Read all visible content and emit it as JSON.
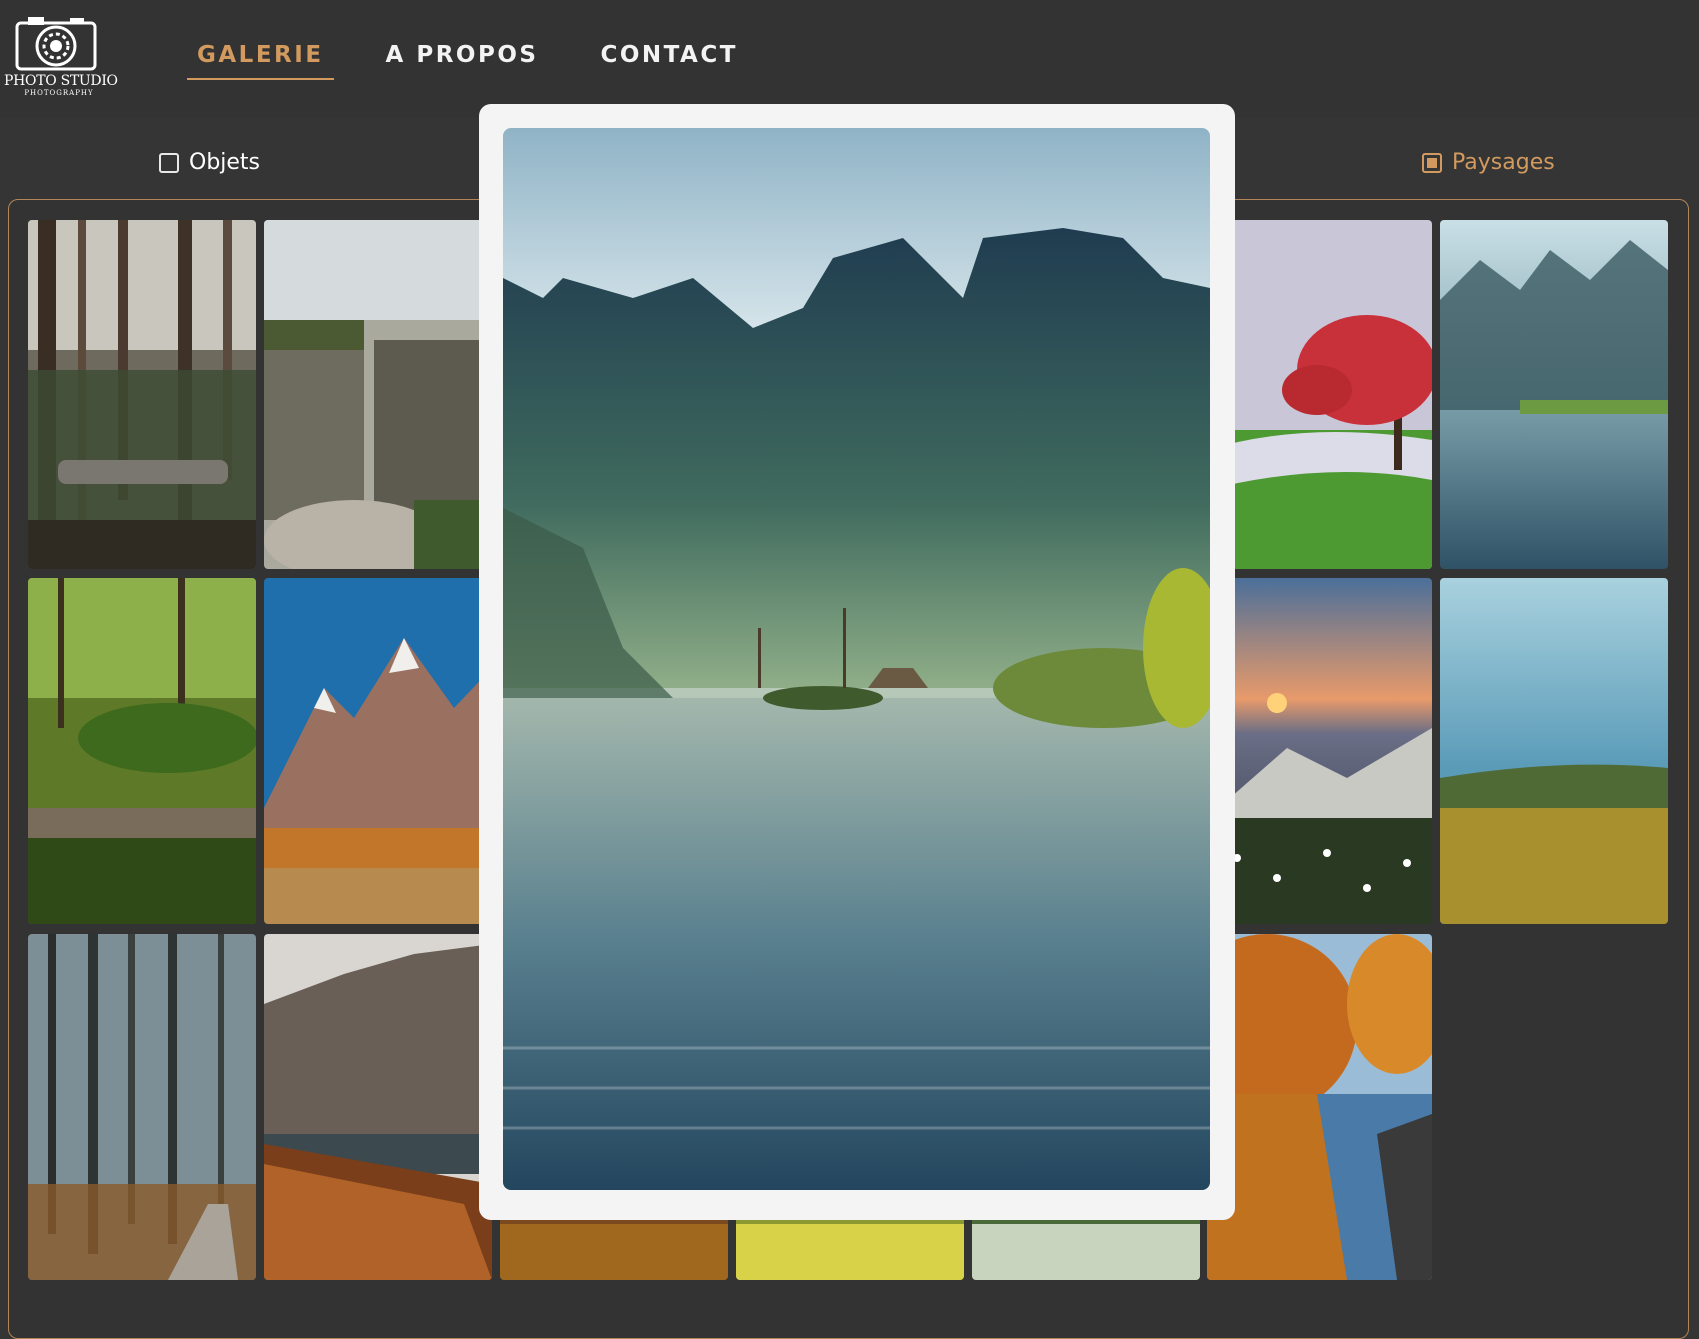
{
  "brand": {
    "name": "PHOTO STUDIO",
    "tagline": "PHOTOGRAPHY",
    "icon": "camera-icon"
  },
  "nav": {
    "items": [
      {
        "label": "GALERIE",
        "active": true
      },
      {
        "label": "A PROPOS",
        "active": false
      },
      {
        "label": "CONTACT",
        "active": false
      }
    ]
  },
  "filters": [
    {
      "label": "Objets",
      "checked": false
    },
    {
      "label": "Paysages",
      "checked": true
    }
  ],
  "colors": {
    "accent": "#d29a5f",
    "background": "#353535",
    "header": "#333333"
  },
  "gallery": {
    "thumbnails": [
      "forest-with-fallen-log",
      "rocky-cliffs-canyon",
      "placeholder",
      "placeholder",
      "placeholder",
      "red-flowering-tree-lawn",
      "misty-lake-island",
      "mossy-stream-forest",
      "snowy-peaks-autumn-field",
      "sunset-mountains-flowers",
      "grassy-hill-sky",
      "misty-pine-forest",
      "mountain-lake-rowboat",
      "autumn-field",
      "yellow-meadow",
      "white-flower-field",
      "autumn-river-rocks"
    ]
  },
  "modal": {
    "image": "misty-lake-mountains-hut",
    "open": true
  }
}
